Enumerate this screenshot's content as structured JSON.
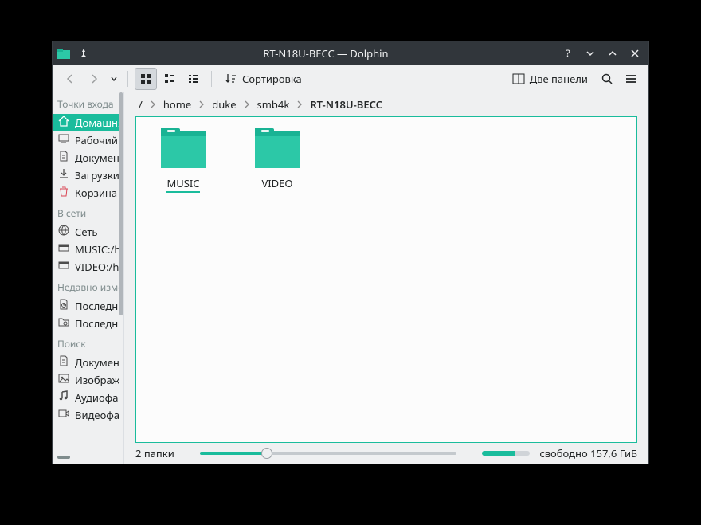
{
  "window": {
    "title": "RT-N18U-BECC — Dolphin"
  },
  "toolbar": {
    "sort_label": "Сортировка",
    "two_panels_label": "Две панели"
  },
  "breadcrumb": {
    "root": "/",
    "segments": [
      "home",
      "duke",
      "smb4k"
    ],
    "current": "RT-N18U-BECC"
  },
  "sidebar": {
    "groups": [
      {
        "title": "Точки входа",
        "items": [
          {
            "icon": "home",
            "label": "Домашняя папка",
            "selected": true
          },
          {
            "icon": "desktop",
            "label": "Рабочий стол"
          },
          {
            "icon": "documents",
            "label": "Документы"
          },
          {
            "icon": "downloads",
            "label": "Загрузки"
          },
          {
            "icon": "trash",
            "label": "Корзина"
          }
        ]
      },
      {
        "title": "В сети",
        "items": [
          {
            "icon": "network",
            "label": "Сеть"
          },
          {
            "icon": "mount",
            "label": "MUSIC:/home"
          },
          {
            "icon": "mount",
            "label": "VIDEO:/home"
          }
        ]
      },
      {
        "title": "Недавно изменённые",
        "items": [
          {
            "icon": "recent-doc",
            "label": "Последние файлы"
          },
          {
            "icon": "recent-folder",
            "label": "Последние места"
          }
        ]
      },
      {
        "title": "Поиск",
        "items": [
          {
            "icon": "documents",
            "label": "Документы"
          },
          {
            "icon": "images",
            "label": "Изображения"
          },
          {
            "icon": "audio",
            "label": "Аудиофайлы"
          },
          {
            "icon": "video",
            "label": "Видеофайлы"
          }
        ]
      }
    ]
  },
  "files": [
    {
      "name": "MUSIC",
      "selected": true
    },
    {
      "name": "VIDEO",
      "selected": false
    }
  ],
  "statusbar": {
    "left": "2 папки",
    "right": "свободно 157,6 ГиБ"
  },
  "colors": {
    "accent": "#1abc9c"
  }
}
